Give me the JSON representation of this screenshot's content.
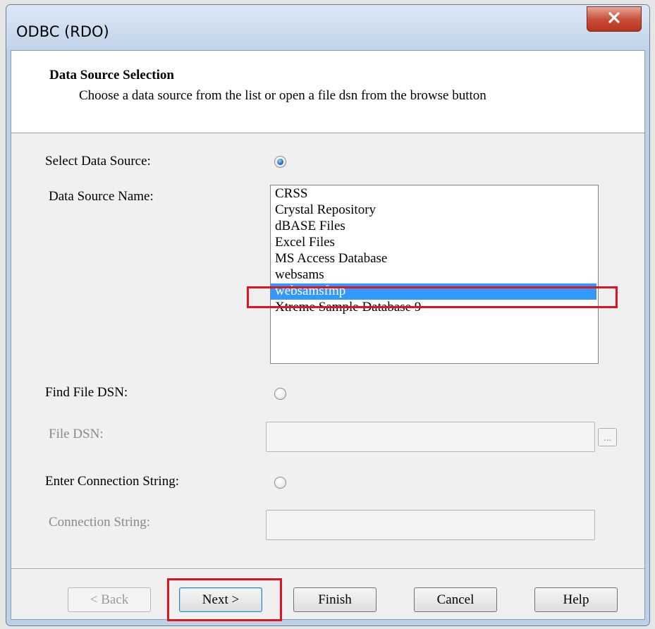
{
  "window": {
    "title": "ODBC (RDO)",
    "close_symbol": "x"
  },
  "header": {
    "title": "Data Source Selection",
    "description": "Choose a data source from the list or open a file dsn from the browse button"
  },
  "select_data_source": {
    "label": "Select Data Source:",
    "selected": true
  },
  "data_source_name": {
    "label": "Data Source Name:",
    "items": [
      "CRSS",
      "Crystal Repository",
      "dBASE Files",
      "Excel Files",
      "MS Access Database",
      "websams",
      "websamsfmp",
      "Xtreme Sample Database 9"
    ],
    "selected_item": "websamsfmp"
  },
  "find_file_dsn": {
    "label": "Find File DSN:",
    "selected": false
  },
  "file_dsn": {
    "label": "File DSN:",
    "value": "",
    "browse_label": "..."
  },
  "enter_connection_string": {
    "label": "Enter Connection String:",
    "selected": false
  },
  "connection_string": {
    "label": "Connection String:",
    "value": ""
  },
  "buttons": {
    "back": "< Back",
    "next": "Next >",
    "finish": "Finish",
    "cancel": "Cancel",
    "help": "Help"
  },
  "colors": {
    "selection": "#3399ff",
    "annotation_red": "#e0141e",
    "close_button": "#c8503a"
  }
}
